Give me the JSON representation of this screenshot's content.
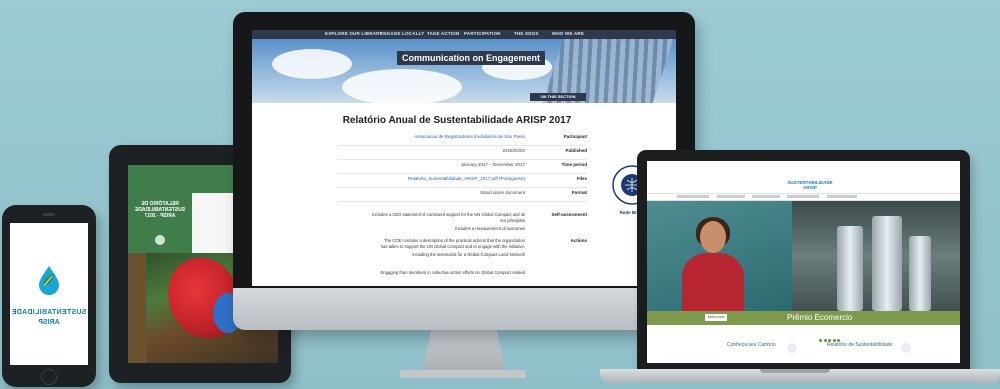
{
  "imac": {
    "nav": [
      "WHO WE ARE",
      "THE SDGS",
      "PARTICIPATION",
      "TAKE ACTION",
      "ENGAGE LOCALLY",
      "EXPLORE OUR LIBRARY"
    ],
    "hero_title": "Communication on Engagement",
    "section_button": "ON THIS SECTION",
    "report_title": "Relatório Anual de Sustentabilidade ARISP 2017",
    "rows": [
      {
        "key": "Participant",
        "value": "Associacao de Registradores Imobiliarios de Sao Paulo",
        "link": true
      },
      {
        "key": "Published",
        "value": "2018/03/02",
        "link": false
      },
      {
        "key": "Time period",
        "value": "January 2017 – December 2017",
        "link": false
      },
      {
        "key": "Files",
        "value": "Relatorio_Sustentabilidade_ARISP_2017.pdf (Portuguese)",
        "link": true
      },
      {
        "key": "Format",
        "value": "Stand alone document",
        "link": false
      }
    ],
    "self_assessment_label": "Self-assessment",
    "self_assessment_lines": [
      "Includes a CEO statement of continued support for the UN Global Compact and its",
      "ten principles",
      "Includes a measurement of outcomes"
    ],
    "actions_label": "Actions",
    "actions_lines": [
      "The COE contains a description of the practical actions that the organization",
      "has taken to support the UN Global Compact and to engage with the initiative,",
      "including the secretariat for a Global Compact Local Network",
      "Engaging than members in collective action efforts on Global Compact related"
    ],
    "badge_label": "Rede Brasil"
  },
  "tablet": {
    "title": "RELATÓRIO DE SUSTENTABILIDADE ARISP - 2017"
  },
  "phone": {
    "logo_line1": "SUSTENTABILIDADE",
    "logo_line2": "ARISP"
  },
  "laptop": {
    "logo": "SUSTENTABILIDADE ARISP",
    "caption": "Prêmio Ecomercio",
    "caption_button": "saiba mais",
    "cards": [
      {
        "title": "Relatório de Sustentabilidade",
        "sub": ""
      },
      {
        "title": "Conheça seu Cartório",
        "sub": ""
      }
    ]
  },
  "colors": {
    "background": "#97c4cd",
    "nav_dark": "#2d3a4e",
    "brand_blue": "#0f7cb0",
    "green": "#3f7e4a",
    "olive": "#7e9a4d"
  }
}
